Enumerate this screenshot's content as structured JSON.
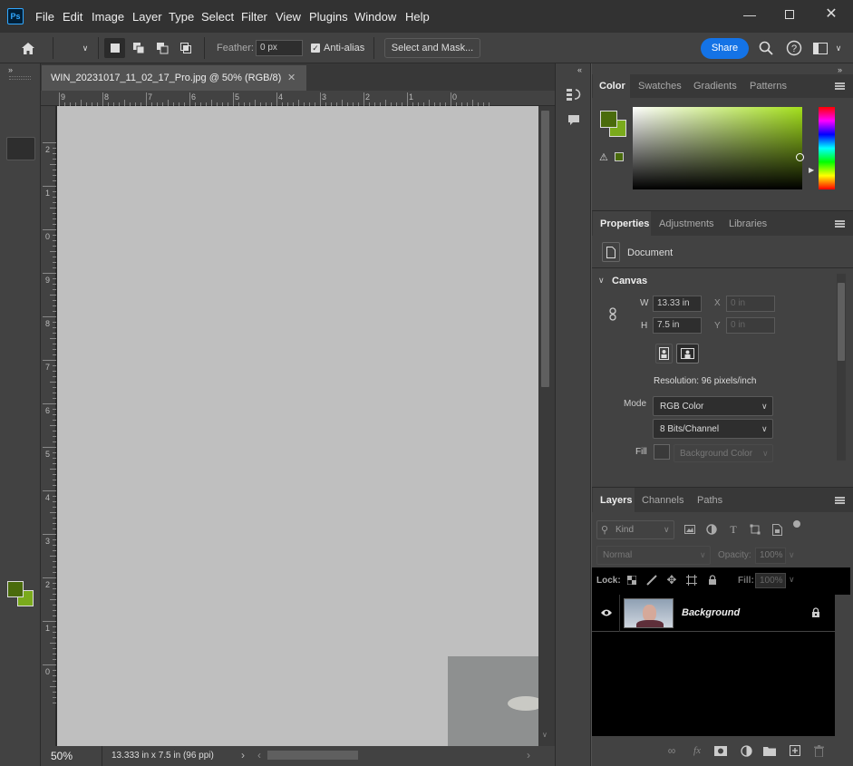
{
  "app": {
    "logo": "Ps"
  },
  "menu": [
    "File",
    "Edit",
    "Image",
    "Layer",
    "Type",
    "Select",
    "Filter",
    "View",
    "Plugins",
    "Window",
    "Help"
  ],
  "options": {
    "feather_label": "Feather:",
    "feather_value": "0 px",
    "antialias_label": "Anti-alias",
    "select_mask_label": "Select and Mask...",
    "share_label": "Share"
  },
  "document": {
    "tab_title": "WIN_20231017_11_02_17_Pro.jpg @ 50% (RGB/8)",
    "zoom": "50%",
    "status": "13.333 in x 7.5 in (96 ppi)"
  },
  "ruler": {
    "h_labels": [
      "9",
      "8",
      "7",
      "6",
      "5",
      "4",
      "3",
      "2",
      "1",
      "0"
    ],
    "v_labels": [
      "2",
      "1",
      "0",
      "9",
      "8",
      "7",
      "6",
      "5",
      "4",
      "3",
      "2",
      "1",
      "0"
    ]
  },
  "color_panel": {
    "tabs": [
      "Color",
      "Swatches",
      "Gradients",
      "Patterns"
    ],
    "active": "Color",
    "foreground": "#4a6b0c",
    "background": "#7aaa1c"
  },
  "properties": {
    "tabs": [
      "Properties",
      "Adjustments",
      "Libraries"
    ],
    "doc_label": "Document",
    "section": "Canvas",
    "w_label": "W",
    "w_value": "13.33 in",
    "h_label": "H",
    "h_value": "7.5 in",
    "x_label": "X",
    "x_placeholder": "0 in",
    "y_label": "Y",
    "y_placeholder": "0 in",
    "resolution": "Resolution: 96 pixels/inch",
    "mode_label": "Mode",
    "mode_value": "RGB Color",
    "bits_value": "8 Bits/Channel",
    "fill_label": "Fill",
    "fill_value": "Background Color"
  },
  "layers": {
    "tabs": [
      "Layers",
      "Channels",
      "Paths"
    ],
    "kind_placeholder": "Kind",
    "blend_mode": "Normal",
    "opacity_label": "Opacity:",
    "opacity_value": "100%",
    "lock_label": "Lock:",
    "fill_label": "Fill:",
    "fill_value": "100%",
    "items": [
      {
        "name": "Background"
      }
    ]
  }
}
